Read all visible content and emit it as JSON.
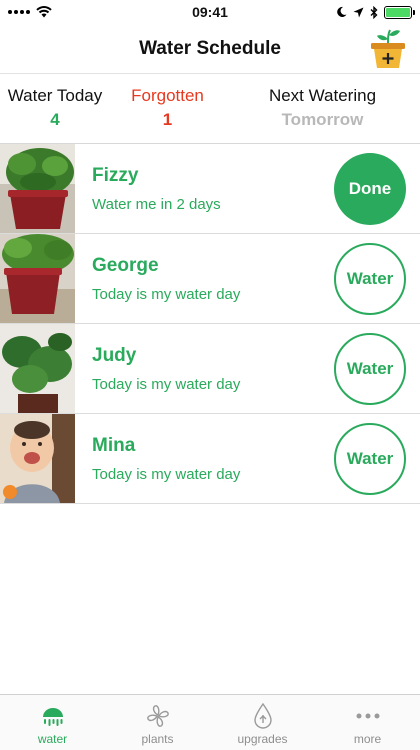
{
  "status_bar": {
    "time": "09:41"
  },
  "nav": {
    "title": "Water Schedule"
  },
  "summary": {
    "water_today": {
      "label": "Water Today",
      "value": "4"
    },
    "forgotten": {
      "label": "Forgotten",
      "value": "1"
    },
    "next_watering": {
      "label": "Next Watering",
      "value": "Tomorrow"
    }
  },
  "plants": [
    {
      "name": "Fizzy",
      "status": "Water me in 2 days",
      "action": "Done"
    },
    {
      "name": "George",
      "status": "Today is my water day",
      "action": "Water"
    },
    {
      "name": "Judy",
      "status": "Today is my water day",
      "action": "Water"
    },
    {
      "name": "Mina",
      "status": "Today is my water day",
      "action": "Water"
    }
  ],
  "tabs": [
    {
      "label": "water",
      "icon": "watering-can-icon",
      "active": true
    },
    {
      "label": "plants",
      "icon": "fan-icon",
      "active": false
    },
    {
      "label": "upgrades",
      "icon": "drop-icon",
      "active": false
    },
    {
      "label": "more",
      "icon": "more-icon",
      "active": false
    }
  ],
  "colors": {
    "accent": "#2aaa5c",
    "alert": "#e6391f",
    "muted": "#b8b8b8",
    "battery": "#4cd964"
  }
}
